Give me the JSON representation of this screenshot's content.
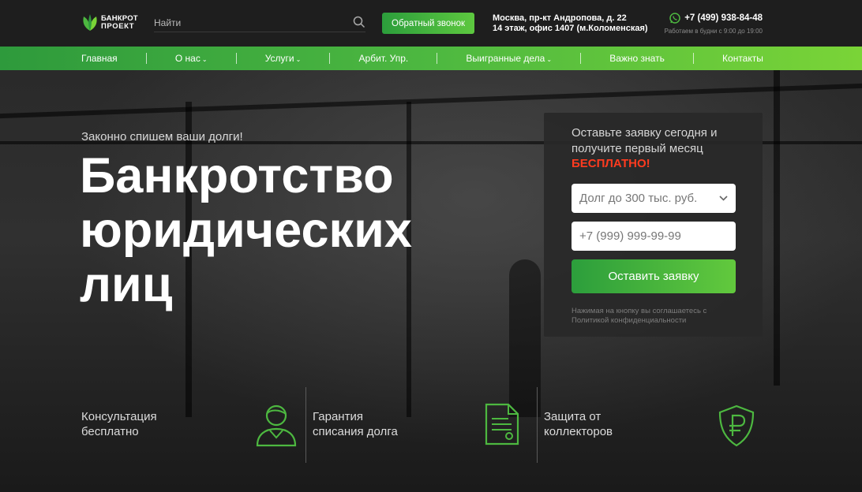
{
  "header": {
    "logo_line1": "БАНКРОТ",
    "logo_line2": "ПРОЕКТ",
    "search_placeholder": "Найти",
    "callback_label": "Обратный звонок",
    "address_line1": "Москва, пр-кт Андропова, д. 22",
    "address_line2": "14 этаж, офис 1407 (м.Коломенская)",
    "phone": "+7 (499) 938-84-48",
    "hours": "Работаем в будни с 9:00 до 19:00"
  },
  "nav": {
    "items": [
      {
        "label": "Главная",
        "dropdown": false
      },
      {
        "label": "О нас",
        "dropdown": true
      },
      {
        "label": "Услуги",
        "dropdown": true
      },
      {
        "label": "Арбит. Упр.",
        "dropdown": false
      },
      {
        "label": "Выигранные дела",
        "dropdown": true
      },
      {
        "label": "Важно знать",
        "dropdown": false
      },
      {
        "label": "Контакты",
        "dropdown": false
      }
    ]
  },
  "hero": {
    "subtitle": "Законно спишем ваши долги!",
    "title_line1": "Банкротство",
    "title_line2": "юридических",
    "title_line3": "лиц"
  },
  "form": {
    "lead_line1": "Оставьте заявку сегодня и",
    "lead_line2": "получите первый месяц",
    "free_label": "БЕСПЛАТНО!",
    "debt_select_value": "Долг до 300 тыс. руб.",
    "phone_placeholder": "+7 (999) 999-99-99",
    "submit_label": "Оставить заявку",
    "privacy_line1": "Нажимая на кнопку вы соглашаетесь с",
    "privacy_line2": "Политикой конфиденциальности"
  },
  "features": [
    {
      "line1": "Консультация",
      "line2": "бесплатно",
      "icon": "consultant-icon"
    },
    {
      "line1": "Гарантия",
      "line2": "списания долга",
      "icon": "document-icon"
    },
    {
      "line1": "Защита от",
      "line2": "коллекторов",
      "icon": "ruble-shield-icon"
    }
  ],
  "colors": {
    "accent": "#4db840",
    "accent_dark": "#2c9e3c",
    "free_text": "#ff3b1f",
    "background": "#1e1e1e"
  }
}
